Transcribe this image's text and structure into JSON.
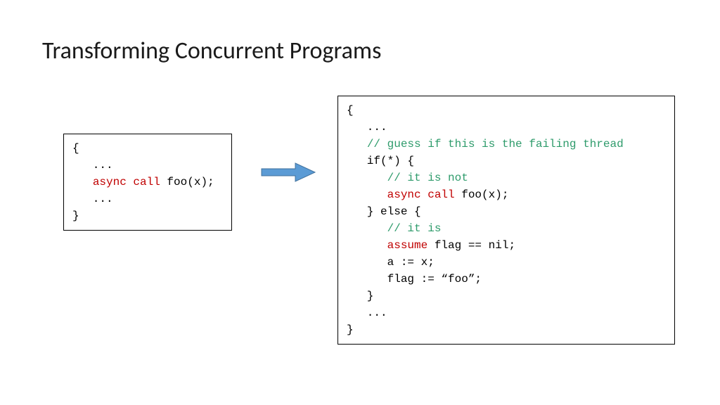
{
  "title": "Transforming Concurrent Programs",
  "leftCode": {
    "l1": "{",
    "l2": "   ...",
    "l3a": "   ",
    "l3kw": "async call",
    "l3b": " foo(x);",
    "l4": "   ...",
    "l5": "}"
  },
  "rightCode": {
    "r1": "{",
    "r2": "   ...",
    "r3a": "   ",
    "r3c": "// guess if this is the failing thread",
    "r4": "   if(*) {",
    "r5a": "      ",
    "r5c": "// it is not",
    "r6a": "      ",
    "r6kw": "async call",
    "r6b": " foo(x);",
    "r7": "   } else {",
    "r8a": "      ",
    "r8c": "// it is",
    "r9a": "      ",
    "r9kw": "assume",
    "r9b": " flag == nil;",
    "r10": "      a := x;",
    "r11": "      flag := “foo”;",
    "r12": "   }",
    "r13": "   ...",
    "r14": "}"
  },
  "arrow": {
    "fill": "#5b9bd5",
    "stroke": "#41719c"
  }
}
